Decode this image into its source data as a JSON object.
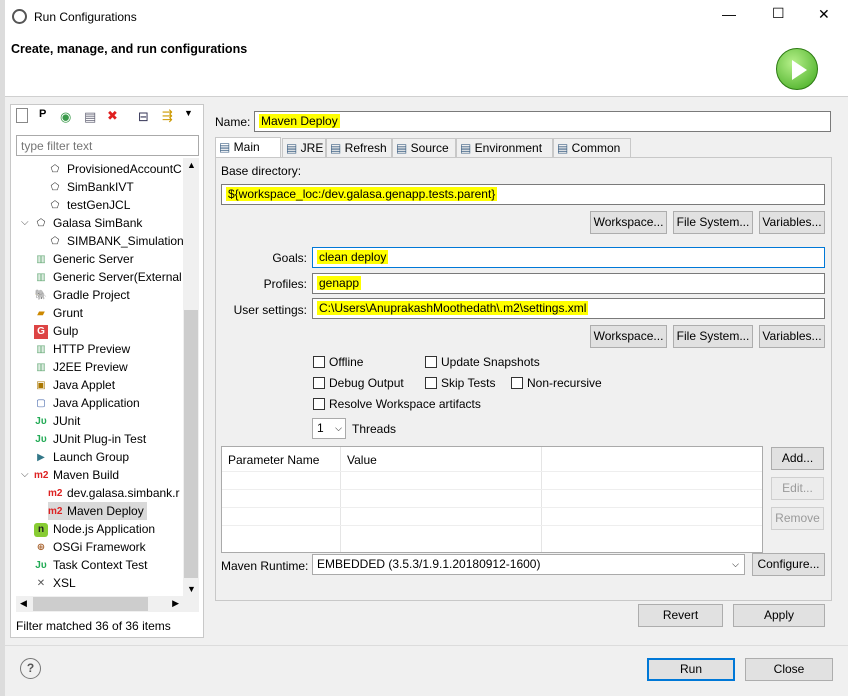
{
  "window": {
    "title": "Run Configurations",
    "header": "Create, manage, and run configurations",
    "minimize": "—",
    "maximize": "☐",
    "close": "✕"
  },
  "sidebar": {
    "filter_placeholder": "type filter text",
    "toolbar": [
      "new-configuration-icon",
      "new-prototype-icon",
      "duplicate-icon",
      "export-icon",
      "delete-icon",
      "collapse-all-icon",
      "filter-icon",
      "menu-chevron-icon"
    ],
    "items": [
      {
        "label": "ProvisionedAccountC",
        "indent": 2,
        "icon": "galasa-icon"
      },
      {
        "label": "SimBankIVT",
        "indent": 2,
        "icon": "galasa-icon"
      },
      {
        "label": "testGenJCL",
        "indent": 2,
        "icon": "galasa-icon"
      },
      {
        "label": "Galasa SimBank",
        "indent": 1,
        "icon": "galasa-icon",
        "expanded": true
      },
      {
        "label": "SIMBANK_Simulation",
        "indent": 2,
        "icon": "galasa-icon"
      },
      {
        "label": "Generic Server",
        "indent": 1,
        "icon": "server-icon"
      },
      {
        "label": "Generic Server(External l",
        "indent": 1,
        "icon": "server-icon"
      },
      {
        "label": "Gradle Project",
        "indent": 1,
        "icon": "gradle-icon"
      },
      {
        "label": "Grunt",
        "indent": 1,
        "icon": "grunt-icon"
      },
      {
        "label": "Gulp",
        "indent": 1,
        "icon": "gulp-icon"
      },
      {
        "label": "HTTP Preview",
        "indent": 1,
        "icon": "server-icon"
      },
      {
        "label": "J2EE Preview",
        "indent": 1,
        "icon": "server-icon"
      },
      {
        "label": "Java Applet",
        "indent": 1,
        "icon": "java-applet-icon"
      },
      {
        "label": "Java Application",
        "indent": 1,
        "icon": "java-application-icon"
      },
      {
        "label": "JUnit",
        "indent": 1,
        "icon": "junit-icon"
      },
      {
        "label": "JUnit Plug-in Test",
        "indent": 1,
        "icon": "junit-plugin-icon"
      },
      {
        "label": "Launch Group",
        "indent": 1,
        "icon": "launch-group-icon"
      },
      {
        "label": "Maven Build",
        "indent": 1,
        "icon": "maven-icon",
        "expanded": true
      },
      {
        "label": "dev.galasa.simbank.r",
        "indent": 2,
        "icon": "maven-icon"
      },
      {
        "label": "Maven Deploy",
        "indent": 2,
        "icon": "maven-icon",
        "selected": true
      },
      {
        "label": "Node.js Application",
        "indent": 1,
        "icon": "nodejs-icon"
      },
      {
        "label": "OSGi Framework",
        "indent": 1,
        "icon": "osgi-icon"
      },
      {
        "label": "Task Context Test",
        "indent": 1,
        "icon": "junit-icon"
      },
      {
        "label": "XSL",
        "indent": 1,
        "icon": "xsl-icon"
      }
    ],
    "status": "Filter matched 36 of 36 items"
  },
  "main": {
    "name_label": "Name:",
    "name_value": "Maven Deploy",
    "tabs": [
      {
        "label": "Main",
        "icon": "main-tab-icon"
      },
      {
        "label": "JRE",
        "icon": "jre-icon"
      },
      {
        "label": "Refresh",
        "icon": "refresh-icon"
      },
      {
        "label": "Source",
        "icon": "source-icon"
      },
      {
        "label": "Environment",
        "icon": "environment-icon"
      },
      {
        "label": "Common",
        "icon": "common-icon"
      }
    ],
    "base_dir_label": "Base directory:",
    "base_dir_value": "${workspace_loc:/dev.galasa.genapp.tests.parent}",
    "workspace": "Workspace...",
    "file_system": "File System...",
    "variables": "Variables...",
    "goals_label": "Goals:",
    "goals_value": "clean deploy",
    "profiles_label": "Profiles:",
    "profiles_value": "genapp",
    "user_settings_label": "User settings:",
    "user_settings_value": "C:\\Users\\AnuprakashMoothedath\\.m2\\settings.xml",
    "checkboxes": {
      "offline": "Offline",
      "update_snapshots": "Update Snapshots",
      "debug_output": "Debug Output",
      "skip_tests": "Skip Tests",
      "non_recursive": "Non-recursive",
      "resolve_workspace": "Resolve Workspace artifacts"
    },
    "threads_value": "1",
    "threads_label": "Threads",
    "table": {
      "columns": [
        "Parameter Name",
        "Value"
      ],
      "rows": []
    },
    "add": "Add...",
    "edit": "Edit...",
    "remove": "Remove",
    "runtime_label": "Maven Runtime:",
    "runtime_value": "EMBEDDED (3.5.3/1.9.1.20180912-1600)",
    "configure": "Configure...",
    "revert": "Revert",
    "apply": "Apply"
  },
  "footer": {
    "help": "?",
    "run": "Run",
    "close": "Close"
  }
}
